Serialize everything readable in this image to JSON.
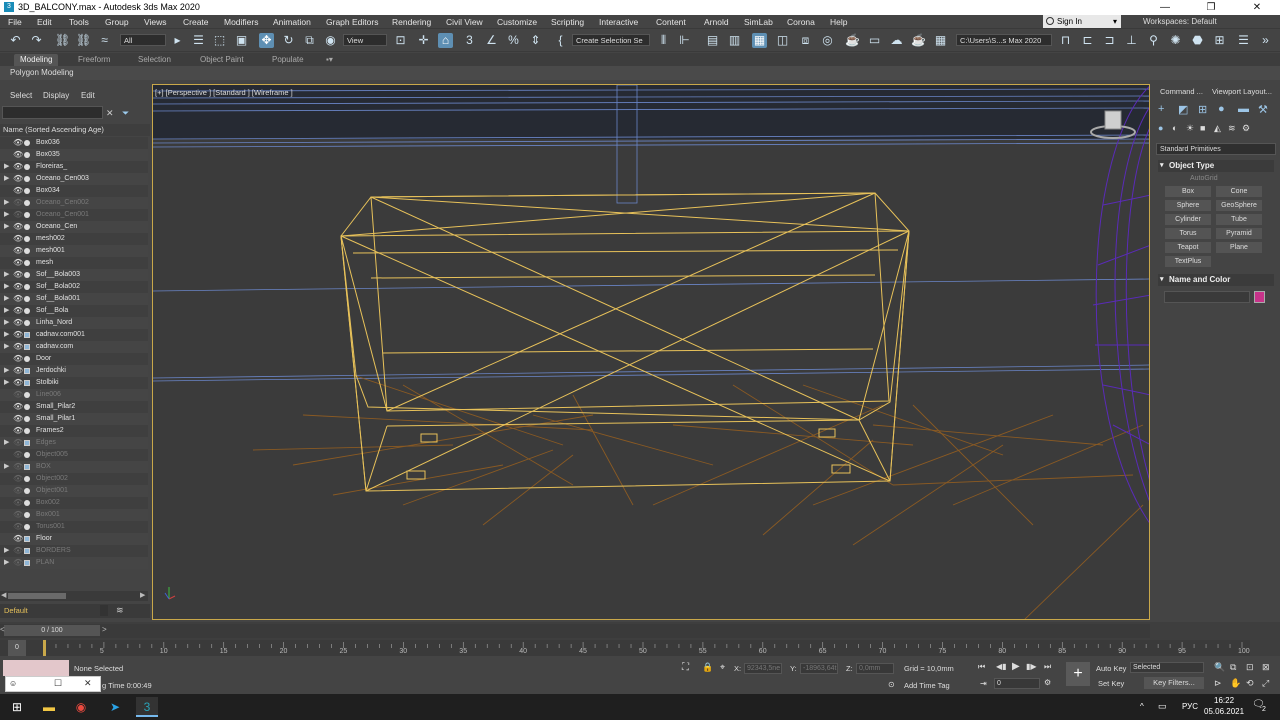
{
  "window": {
    "title": "3D_BALCONY.max - Autodesk 3ds Max 2020",
    "app_icon": "3",
    "controls": [
      "—",
      "❐",
      "✕"
    ]
  },
  "menu": [
    "File",
    "Edit",
    "Tools",
    "Group",
    "Views",
    "Create",
    "Modifiers",
    "Animation",
    "Graph Editors",
    "Rendering",
    "Civil View",
    "Customize",
    "Scripting",
    "Interactive",
    "Content",
    "Arnold",
    "SimLab",
    "Corona",
    "Help"
  ],
  "signin": "Sign In",
  "workspaces": {
    "label": "Workspaces:",
    "value": "Default"
  },
  "toolbar": {
    "selection_filter": "All",
    "ref_coord": "View",
    "named_sel": "Create Selection Se",
    "path": "C:\\Users\\S...s Max 2020"
  },
  "ribbon": {
    "tabs": [
      "Modeling",
      "Freeform",
      "Selection",
      "Object Paint",
      "Populate"
    ],
    "active": "Modeling",
    "sub": "Polygon Modeling"
  },
  "explorer": {
    "menu": [
      "Select",
      "Display",
      "Edit"
    ],
    "header": "Name (Sorted Ascending Age)",
    "rows": [
      {
        "name": "Box036",
        "expand": false,
        "hidden": false,
        "group": false
      },
      {
        "name": "Box035",
        "expand": false,
        "hidden": false,
        "group": false
      },
      {
        "name": "Floreiras_",
        "expand": true,
        "hidden": false,
        "group": false
      },
      {
        "name": "Oceano_Cen003",
        "expand": true,
        "hidden": false,
        "group": false
      },
      {
        "name": "Box034",
        "expand": false,
        "hidden": false,
        "group": false
      },
      {
        "name": "Oceano_Cen002",
        "expand": true,
        "hidden": true,
        "group": false
      },
      {
        "name": "Oceano_Cen001",
        "expand": true,
        "hidden": true,
        "group": false
      },
      {
        "name": "Oceano_Cen",
        "expand": true,
        "hidden": false,
        "group": false
      },
      {
        "name": "mesh002",
        "expand": false,
        "hidden": false,
        "group": false
      },
      {
        "name": "mesh001",
        "expand": false,
        "hidden": false,
        "group": false
      },
      {
        "name": "mesh",
        "expand": false,
        "hidden": false,
        "group": false
      },
      {
        "name": "Sof__Bola003",
        "expand": true,
        "hidden": false,
        "group": false
      },
      {
        "name": "Sof__Bola002",
        "expand": true,
        "hidden": false,
        "group": false
      },
      {
        "name": "Sof__Bola001",
        "expand": true,
        "hidden": false,
        "group": false
      },
      {
        "name": "Sof__Bola",
        "expand": true,
        "hidden": false,
        "group": false
      },
      {
        "name": "Linha_Nord",
        "expand": true,
        "hidden": false,
        "group": false
      },
      {
        "name": "cadnav.com001",
        "expand": true,
        "hidden": false,
        "group": true
      },
      {
        "name": "cadnav.com",
        "expand": true,
        "hidden": false,
        "group": true
      },
      {
        "name": "Door",
        "expand": false,
        "hidden": false,
        "group": false
      },
      {
        "name": "Jerdochki",
        "expand": true,
        "hidden": false,
        "group": true
      },
      {
        "name": "Stolbiki",
        "expand": true,
        "hidden": false,
        "group": true
      },
      {
        "name": "Line006",
        "expand": false,
        "hidden": true,
        "group": false
      },
      {
        "name": "Small_Pilar2",
        "expand": false,
        "hidden": false,
        "group": false
      },
      {
        "name": "Small_Pilar1",
        "expand": false,
        "hidden": false,
        "group": false
      },
      {
        "name": "Frames2",
        "expand": false,
        "hidden": false,
        "group": false
      },
      {
        "name": "Edges",
        "expand": true,
        "hidden": true,
        "group": true
      },
      {
        "name": "Object005",
        "expand": false,
        "hidden": true,
        "group": false
      },
      {
        "name": "BOX",
        "expand": true,
        "hidden": true,
        "group": true
      },
      {
        "name": "Object002",
        "expand": false,
        "hidden": true,
        "group": false
      },
      {
        "name": "Object001",
        "expand": false,
        "hidden": true,
        "group": false
      },
      {
        "name": "Box002",
        "expand": false,
        "hidden": true,
        "group": false
      },
      {
        "name": "Box001",
        "expand": false,
        "hidden": true,
        "group": false
      },
      {
        "name": "Torus001",
        "expand": false,
        "hidden": true,
        "group": false
      },
      {
        "name": "Floor",
        "expand": false,
        "hidden": false,
        "group": true
      },
      {
        "name": "BORDERS",
        "expand": true,
        "hidden": true,
        "group": true
      },
      {
        "name": "PLAN",
        "expand": true,
        "hidden": true,
        "group": true
      }
    ],
    "layer": "Default"
  },
  "viewport": {
    "label": "[+] [Perspective ] [Standard ] [Wireframe ]"
  },
  "command_panel": {
    "tabs": [
      "Command ...",
      "Viewport Layout..."
    ],
    "category": "Standard Primitives",
    "object_type_title": "Object Type",
    "autogrid": "AutoGrid",
    "buttons": [
      "Box",
      "Cone",
      "Sphere",
      "GeoSphere",
      "Cylinder",
      "Tube",
      "Torus",
      "Pyramid",
      "Teapot",
      "Plane",
      "TextPlus"
    ],
    "name_color_title": "Name and Color",
    "swatch_color": "#c8338a"
  },
  "timeline": {
    "frame": "0 / 100",
    "ticks": [
      "5",
      "10",
      "15",
      "20",
      "25",
      "30",
      "35",
      "40",
      "45",
      "50",
      "55",
      "60",
      "65",
      "70",
      "75",
      "80",
      "85",
      "90",
      "95",
      "100"
    ],
    "start_tick": "0"
  },
  "status": {
    "selection": "None Selected",
    "time": "g Time  0:00:49",
    "x_label": "X:",
    "x": "92343,5ne",
    "y_label": "Y:",
    "y": "-18963,64t",
    "z_label": "Z:",
    "z": "0,0mm",
    "grid": "Grid = 10,0mm",
    "add_time_tag": "Add Time Tag",
    "auto_key": "Auto Key",
    "selected": "Selected",
    "set_key": "Set Key",
    "key_filters": "Key Filters...",
    "frame": "0"
  },
  "taskbar": {
    "lang": "РУС",
    "time": "16:22",
    "date": "05.06.2021",
    "notif": "2"
  }
}
